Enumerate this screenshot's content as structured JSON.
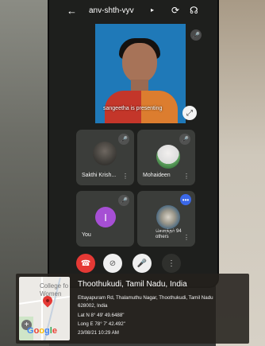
{
  "meeting": {
    "title": "anv-shth-vyv",
    "presenting_text": "sangeetha is presenting"
  },
  "participants": [
    {
      "name": "Sakthi Krish..."
    },
    {
      "name": "Mohaideen"
    },
    {
      "name": "You",
      "initial": "I"
    },
    {
      "name": "சௌந்தர்",
      "others": "94 others"
    }
  ],
  "geo": {
    "place": "Thoothukudi, Tamil Nadu, India",
    "address_line1": "Ettayapuram Rd, Thalamuthu Nagar, Thoothukudi, Tamil Nadu",
    "address_line2": "628002, India",
    "lat": "Lat N 8° 49' 49.6488\"",
    "long": "Long E 78° 7' 42.492\"",
    "timestamp": "23/08/21 10:29 AM"
  },
  "map": {
    "label_1": "College fo",
    "label_2": "Women",
    "brand": "Google"
  },
  "colors": {
    "phone_bg": "#1e1f1d",
    "tile_bg": "#3b3d3a",
    "accent_purple": "#a64fd4",
    "accent_blue": "#3b68e8",
    "end_call_red": "#e53935"
  }
}
